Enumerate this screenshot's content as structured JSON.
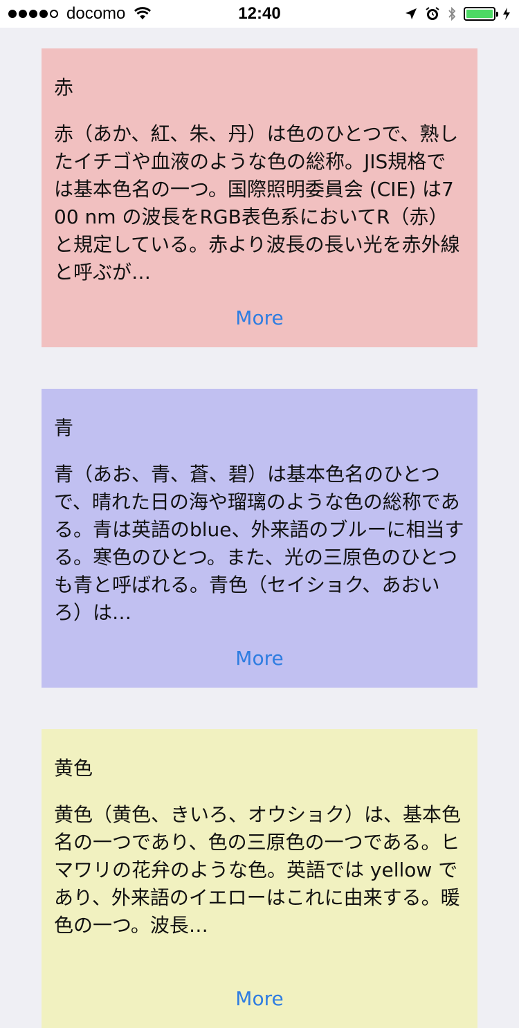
{
  "status_bar": {
    "carrier": "docomo",
    "time": "12:40",
    "battery_color": "#4cd964"
  },
  "cards": [
    {
      "title": "赤",
      "body": "赤（あか、紅、朱、丹）は色のひとつで、熟したイチゴや血液のような色の総称。JIS規格では基本色名の一つ。国際照明委員会 (CIE) は700 nm の波長をRGB表色系においてR（赤）と規定している。赤より波長の長い光を赤外線と呼ぶが…",
      "more_label": "More",
      "bg": "#f1c0c0"
    },
    {
      "title": "青",
      "body": "青（あお、青、蒼、碧）は基本色名のひとつで、晴れた日の海や瑠璃のような色の総称である。青は英語のblue、外来語のブルーに相当する。寒色のひとつ。また、光の三原色のひとつも青と呼ばれる。青色（セイショク、あおいろ）は…",
      "more_label": "More",
      "bg": "#c1c0f1"
    },
    {
      "title": "黄色",
      "body": "黄色（黄色、きいろ、オウショク）は、基本色名の一つであり、色の三原色の一つである。ヒマワリの花弁のような色。英語では yellow であり、外来語のイエローはこれに由来する。暖色の一つ。波長…",
      "more_label": "More",
      "bg": "#f1f1c0"
    }
  ]
}
